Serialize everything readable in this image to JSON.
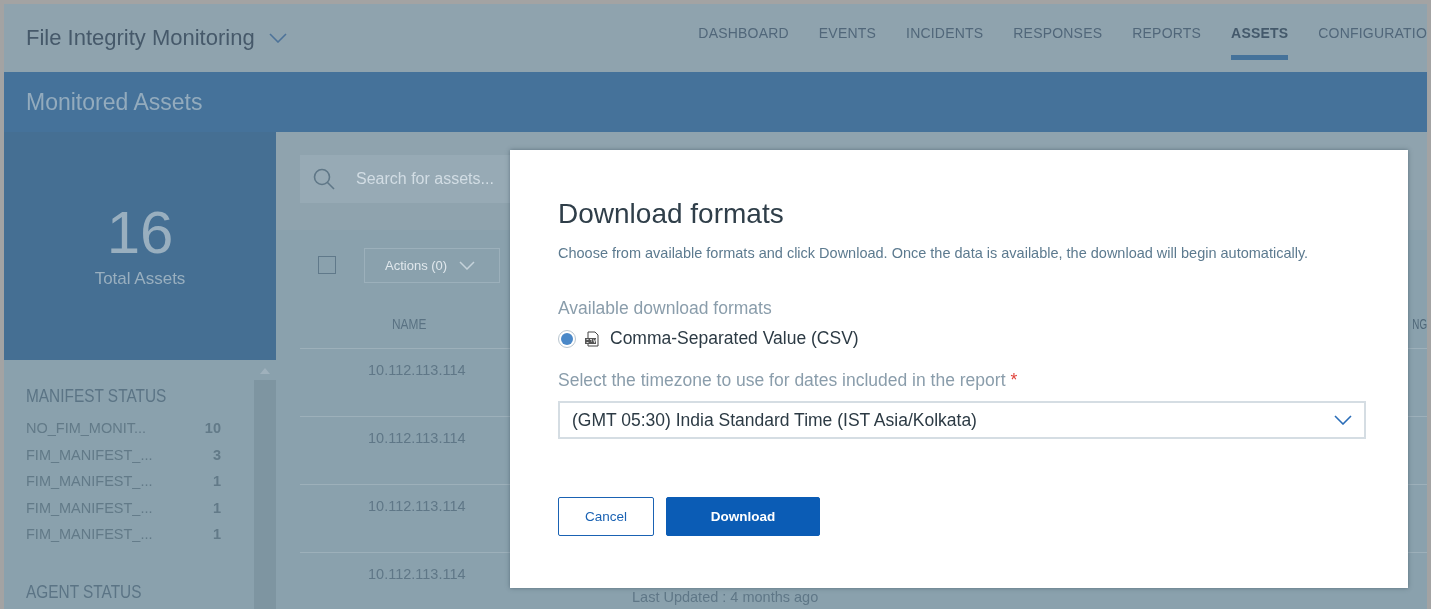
{
  "app": {
    "title": "File Integrity Monitoring"
  },
  "nav": [
    {
      "label": "DASHBOARD",
      "selected": false
    },
    {
      "label": "EVENTS",
      "selected": false
    },
    {
      "label": "INCIDENTS",
      "selected": false
    },
    {
      "label": "RESPONSES",
      "selected": false
    },
    {
      "label": "REPORTS",
      "selected": false
    },
    {
      "label": "ASSETS",
      "selected": true
    },
    {
      "label": "CONFIGURATIO",
      "selected": false
    }
  ],
  "page_title": "Monitored Assets",
  "summary": {
    "count": "16",
    "label": "Total Assets"
  },
  "manifest_status": {
    "heading": "MANIFEST STATUS",
    "items": [
      {
        "label": "NO_FIM_MONIT...",
        "count": "10"
      },
      {
        "label": "FIM_MANIFEST_...",
        "count": "3"
      },
      {
        "label": "FIM_MANIFEST_...",
        "count": "1"
      },
      {
        "label": "FIM_MANIFEST_...",
        "count": "1"
      },
      {
        "label": "FIM_MANIFEST_...",
        "count": "1"
      }
    ]
  },
  "agent_status": {
    "heading": "AGENT STATUS"
  },
  "search": {
    "placeholder": "Search for assets..."
  },
  "toolbar": {
    "select_all_checked": false,
    "actions": "Actions (0)"
  },
  "table": {
    "columns": [
      "NAME",
      "NG"
    ],
    "rows": [
      {
        "name": "10.112.113.114"
      },
      {
        "name": "10.112.113.114"
      },
      {
        "name": "10.112.113.114"
      },
      {
        "name": "10.112.113.114",
        "detail": "Last Updated : 4 months ago"
      }
    ]
  },
  "dialog": {
    "title": "Download formats",
    "description": "Choose from available formats and click Download. Once the data is available, the download will begin automatically.",
    "formats_label": "Available download formats",
    "formats": [
      {
        "label": "Comma-Separated Value (CSV)",
        "selected": true
      }
    ],
    "timezone_label": "Select the timezone to use for dates included in the report",
    "required_mark": "*",
    "timezone_value": "(GMT 05:30) India Standard Time (IST Asia/Kolkata)",
    "buttons": [
      {
        "label": "Cancel",
        "kind": "secondary"
      },
      {
        "label": "Download",
        "kind": "primary"
      }
    ]
  }
}
